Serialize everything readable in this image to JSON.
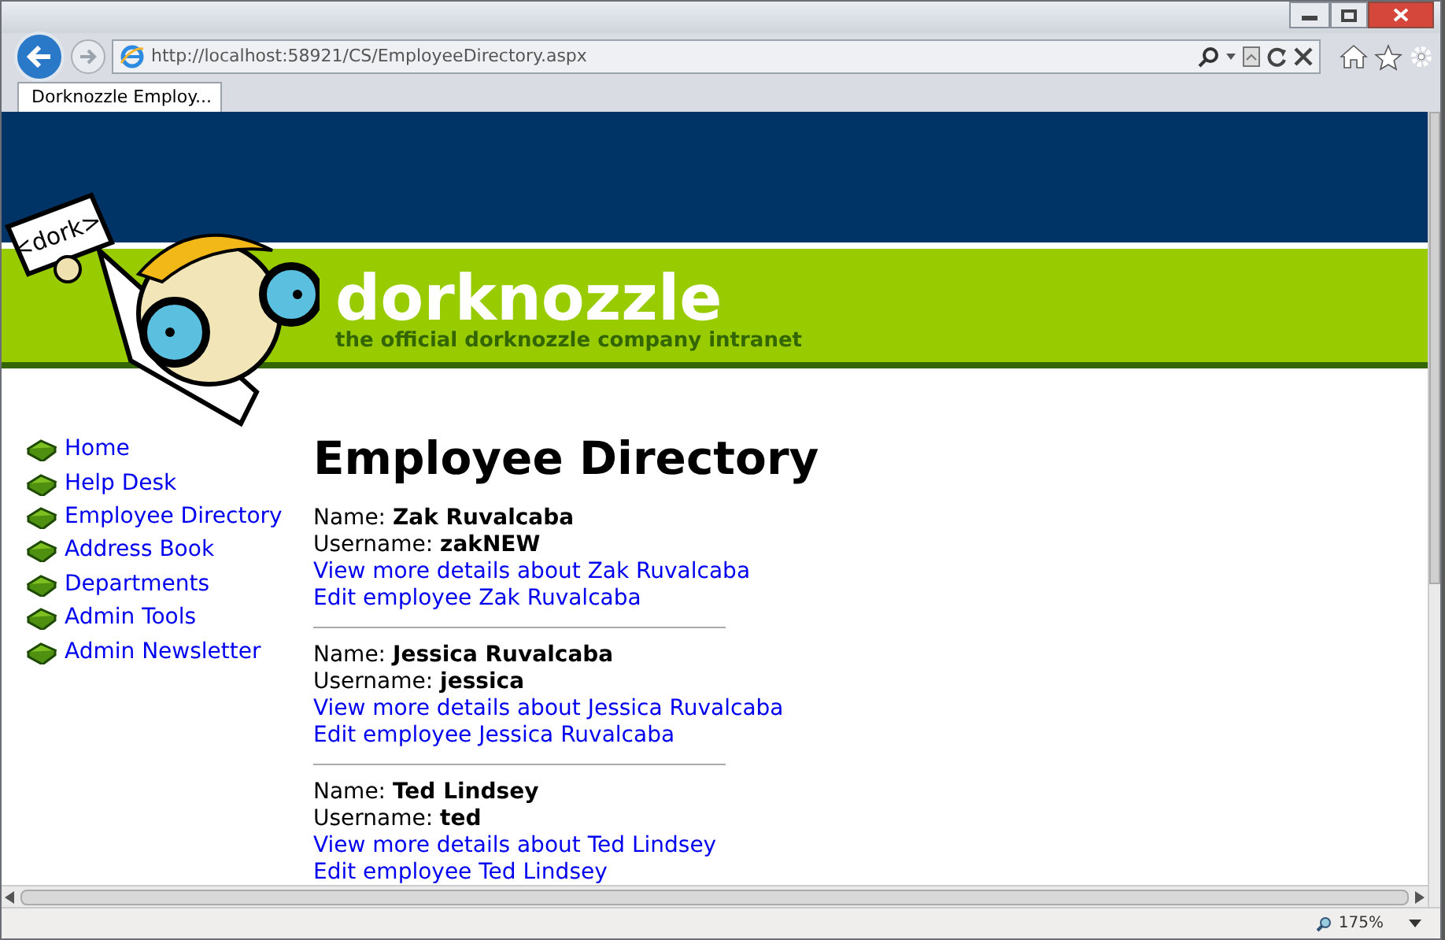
{
  "browser": {
    "address": "http://localhost:58921/CS/EmployeeDirectory.aspx",
    "tabs": [
      {
        "title": "Dorknozzle Employ...",
        "selected": true
      }
    ],
    "zoom": "175%"
  },
  "header": {
    "sign": "<dork>",
    "title": "dorknozzle",
    "tagline": "the official dorknozzle company intranet"
  },
  "nav": [
    "Home",
    "Help Desk",
    "Employee Directory",
    "Address Book",
    "Departments",
    "Admin Tools",
    "Admin Newsletter"
  ],
  "heading": "Employee Directory",
  "employees": [
    {
      "name_label": "Name:",
      "name": "Zak Ruvalcaba",
      "username_label": "Username:",
      "username": "zakNEW",
      "details_link": "View more details about Zak Ruvalcaba",
      "edit_link": "Edit employee Zak Ruvalcaba"
    },
    {
      "name_label": "Name:",
      "name": "Jessica Ruvalcaba",
      "username_label": "Username:",
      "username": "jessica",
      "details_link": "View more details about Jessica Ruvalcaba",
      "edit_link": "Edit employee Jessica Ruvalcaba"
    },
    {
      "name_label": "Name:",
      "name": "Ted Lindsey",
      "username_label": "Username:",
      "username": "ted",
      "details_link": "View more details about Ted Lindsey",
      "edit_link": "Edit employee Ted Lindsey"
    }
  ]
}
